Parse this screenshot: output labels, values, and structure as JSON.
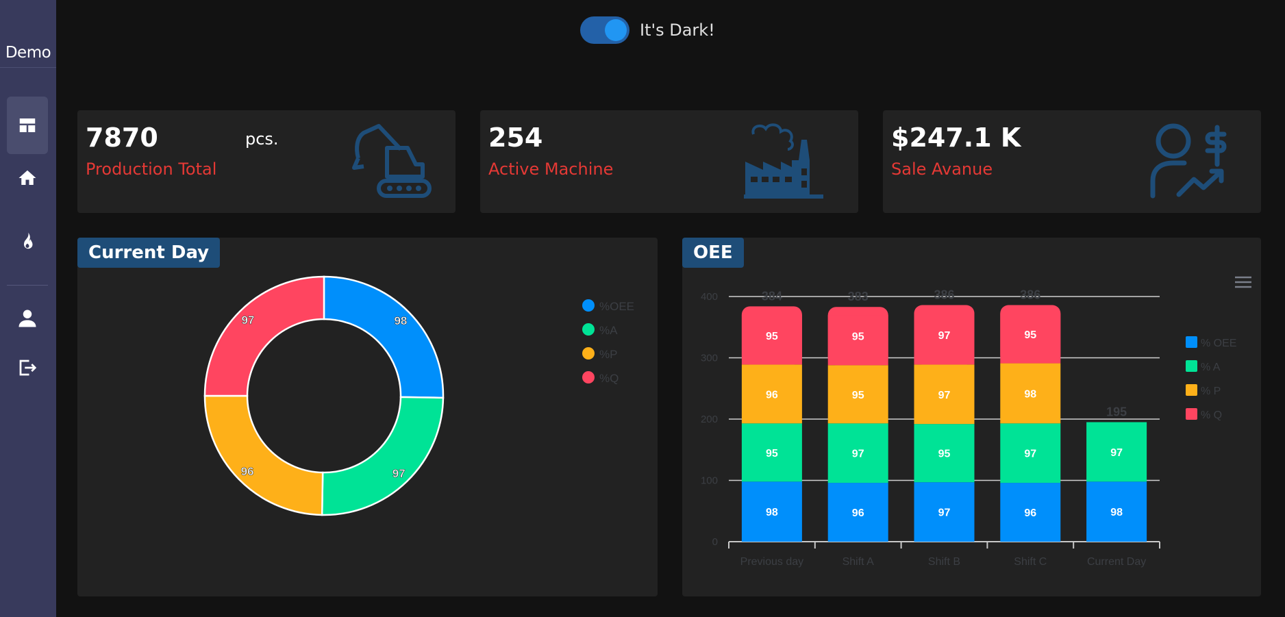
{
  "sidebar": {
    "brand": "Demo",
    "items": [
      {
        "name": "dashboard",
        "icon": "dashboard-icon",
        "active": true
      },
      {
        "name": "home",
        "icon": "home-icon"
      },
      {
        "name": "fire",
        "icon": "fire-icon"
      },
      {
        "name": "user",
        "icon": "user-icon"
      },
      {
        "name": "logout",
        "icon": "logout-icon"
      }
    ]
  },
  "theme_toggle": {
    "label": "It's Dark!",
    "on": true
  },
  "cards": [
    {
      "value": "7870",
      "unit": "pcs.",
      "label": "Production Total",
      "icon": "excavator-icon"
    },
    {
      "value": "254",
      "label": "Active Machine",
      "icon": "factory-icon"
    },
    {
      "value": "$247.1 K",
      "label": "Sale Avanue",
      "icon": "user-dollar-icon"
    }
  ],
  "colors": {
    "oee": "#008ffb",
    "a": "#00e396",
    "p": "#feb019",
    "q": "#ff4560",
    "accent_label": "#e53935",
    "icon": "#1e4d78"
  },
  "current_day": {
    "title": "Current Day"
  },
  "oee": {
    "title": "OEE",
    "menu_icon": "hamburger-menu-icon"
  },
  "chart_data": [
    {
      "type": "pie",
      "variant": "donut",
      "title": "Current Day",
      "categories": [
        "%OEE",
        "%A",
        "%P",
        "%Q"
      ],
      "values": [
        98,
        97,
        96,
        97
      ],
      "legend": "top-right"
    },
    {
      "type": "bar",
      "stacked": true,
      "title": "OEE",
      "categories": [
        "Previous day",
        "Shift A",
        "Shift B",
        "Shift C",
        "Current Day"
      ],
      "series": [
        {
          "name": "% OEE",
          "values": [
            98,
            96,
            97,
            96,
            98
          ]
        },
        {
          "name": "% A",
          "values": [
            95,
            97,
            95,
            97,
            97
          ]
        },
        {
          "name": "% P",
          "values": [
            96,
            95,
            97,
            98,
            null
          ]
        },
        {
          "name": "% Q",
          "values": [
            95,
            95,
            97,
            95,
            null
          ]
        }
      ],
      "totals": [
        384,
        383,
        386,
        386,
        195
      ],
      "ylim": [
        0,
        400
      ],
      "yticks": [
        0,
        100,
        200,
        300,
        400
      ],
      "grid": true,
      "legend": "right"
    }
  ]
}
